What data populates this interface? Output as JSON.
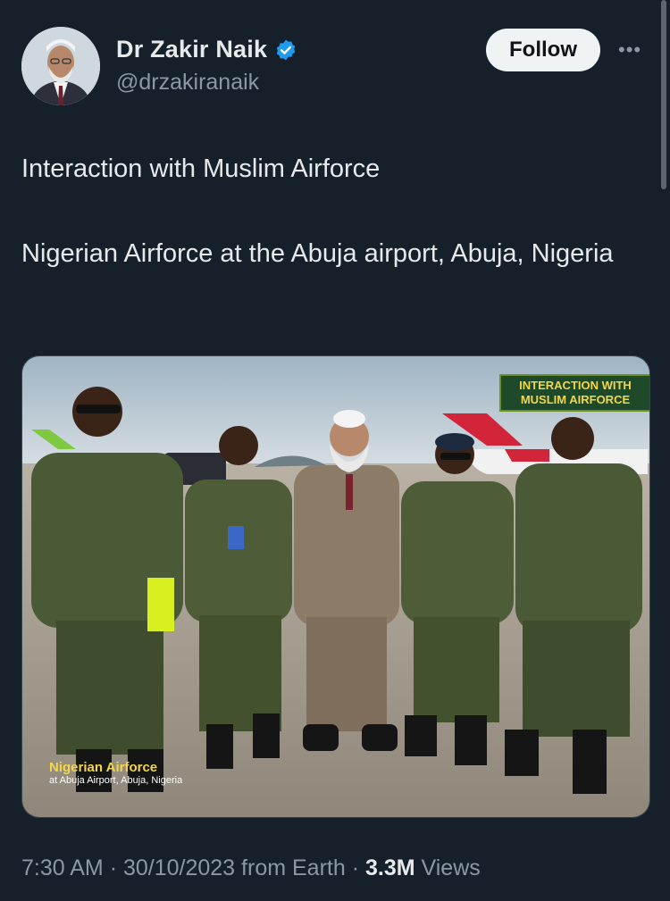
{
  "author": {
    "name": "Dr Zakir Naik",
    "handle": "@drzakiranaik",
    "verified": true,
    "avatar_icon": "profile-photo"
  },
  "follow_label": "Follow",
  "more_icon": "more-horizontal-icon",
  "tweet": {
    "line1": "Interaction with Muslim Airforce",
    "line2": "Nigerian Airforce at the Abuja airport, Abuja, Nigeria"
  },
  "media": {
    "badge_line1": "INTERACTION WITH",
    "badge_line2": "MUSLIM AIRFORCE",
    "caption_line1": "Nigerian Airforce",
    "caption_line2": "at Abuja Airport, Abuja, Nigeria"
  },
  "meta": {
    "time": "7:30 AM",
    "separator": "·",
    "date": "30/10/2023",
    "source": "from Earth",
    "views_count": "3.3M",
    "views_label": "Views"
  },
  "colors": {
    "background": "#15202b",
    "text": "#e7e9ea",
    "secondary": "#8b98a5",
    "verified": "#1d9bf0"
  }
}
